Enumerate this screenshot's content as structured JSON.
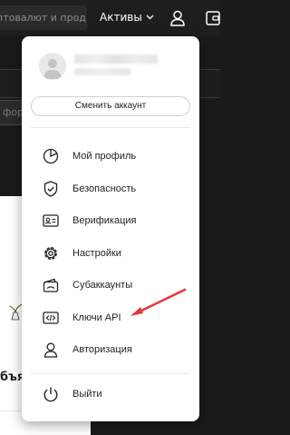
{
  "header": {
    "search_text": "птовалют и прод...",
    "assets_label": "Активы"
  },
  "background": {
    "field_text": "форі",
    "white_panel_word": "бъя"
  },
  "menu": {
    "switch_account_label": "Сменить аккаунт",
    "items": [
      {
        "label": "Мой профиль",
        "icon": "pie-chart-icon"
      },
      {
        "label": "Безопасность",
        "icon": "shield-check-icon"
      },
      {
        "label": "Верификация",
        "icon": "id-card-icon"
      },
      {
        "label": "Настройки",
        "icon": "gear-icon"
      },
      {
        "label": "Субаккаунты",
        "icon": "wallet-icon"
      },
      {
        "label": "Ключи API",
        "icon": "api-key-icon"
      },
      {
        "label": "Авторизация",
        "icon": "person-icon"
      }
    ],
    "logout_label": "Выйти"
  },
  "colors": {
    "annotation_arrow": "#e53935",
    "menu_bg": "#ffffff",
    "topbar_bg": "#1e1e1e"
  }
}
